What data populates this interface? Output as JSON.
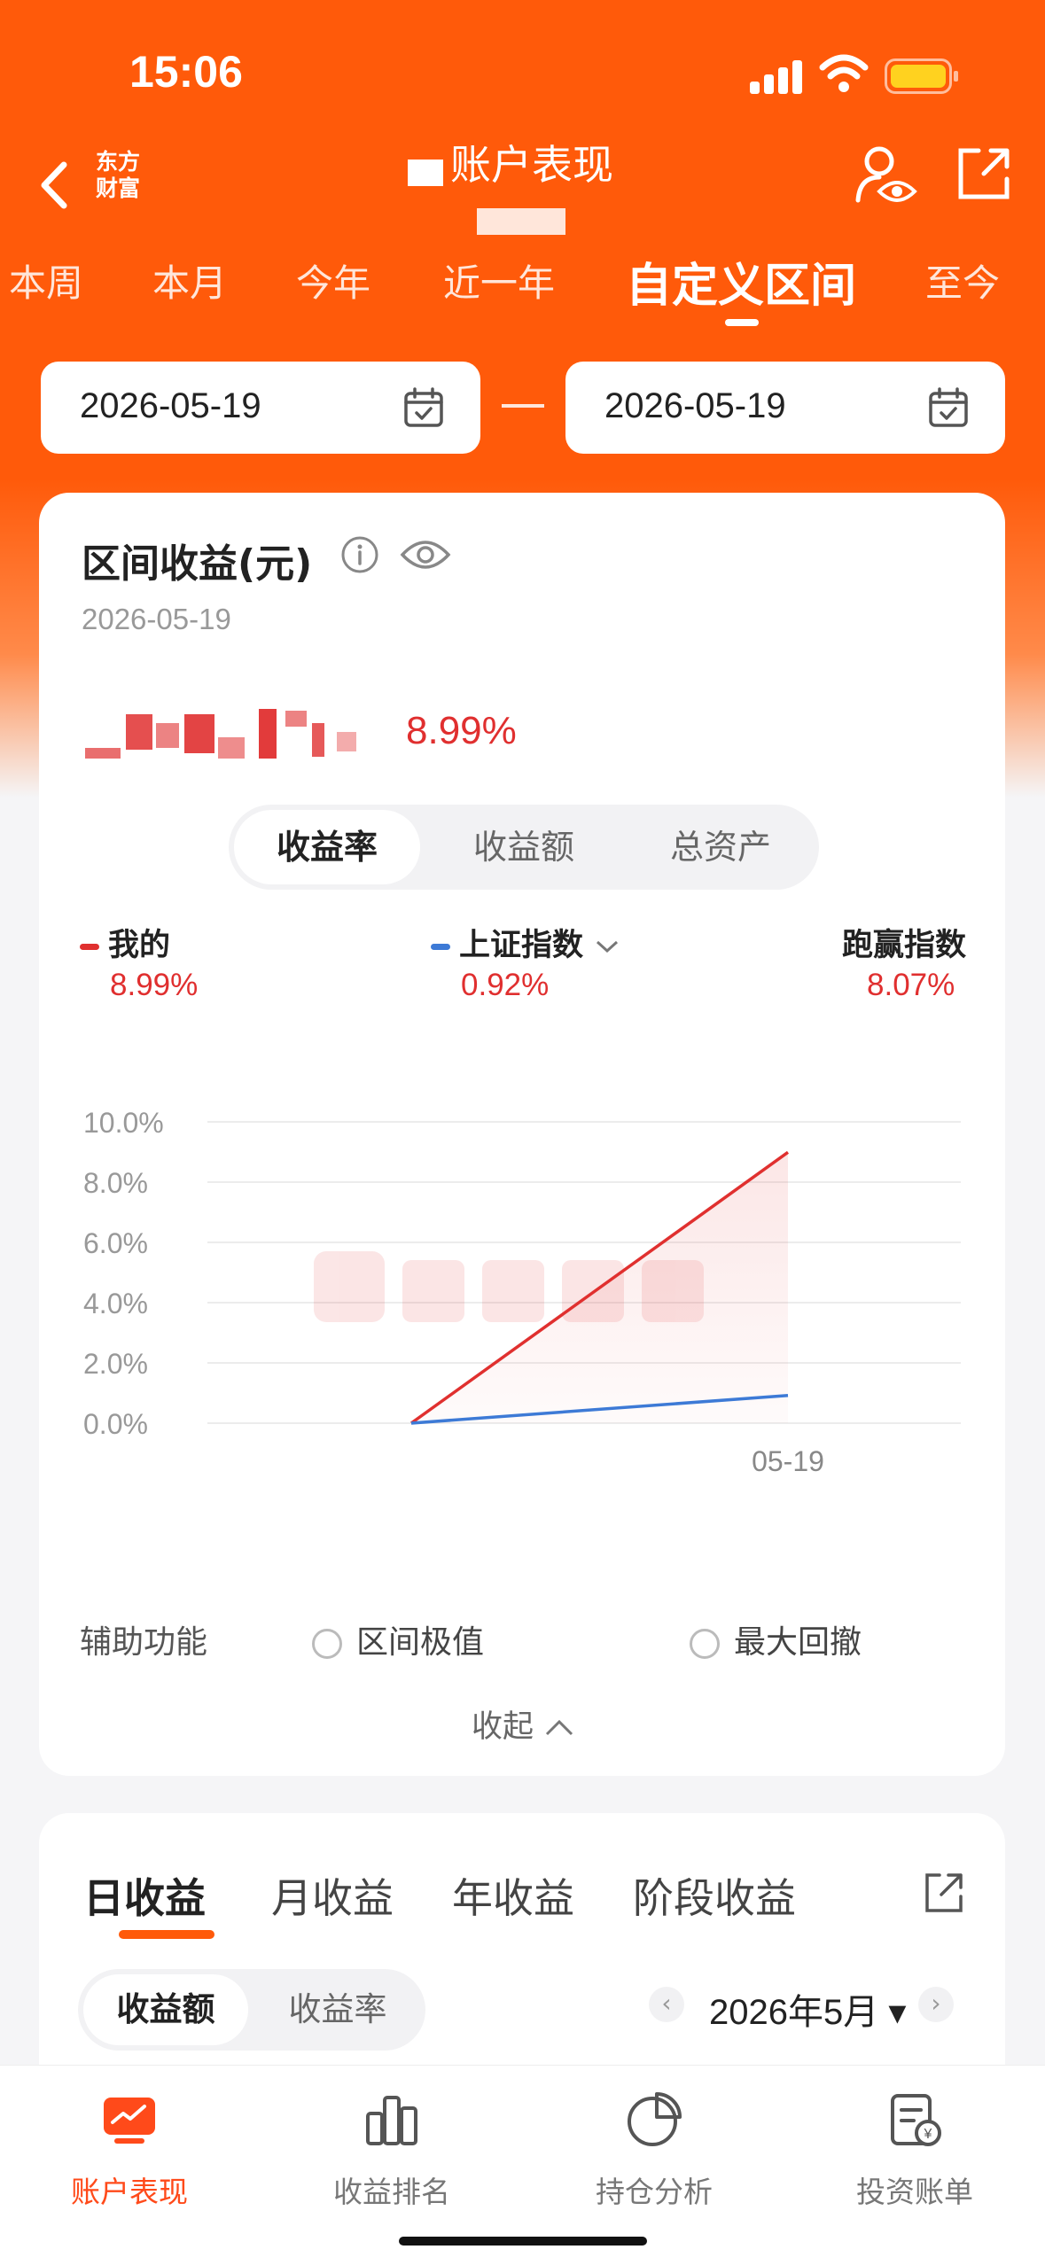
{
  "status": {
    "time": "15:06"
  },
  "nav": {
    "logo_line1": "东方",
    "logo_line2": "财富",
    "title": "账户表现"
  },
  "period_tabs": [
    "本周",
    "本月",
    "今年",
    "近一年",
    "自定义区间",
    "至今"
  ],
  "date_range": {
    "start": "2026-05-19",
    "end": "2026-05-19"
  },
  "summary": {
    "title": "区间收益(元)",
    "date": "2026-05-19",
    "return_pct": "8.99%"
  },
  "segment": [
    "收益率",
    "收益额",
    "总资产"
  ],
  "legend": [
    {
      "label": "我的",
      "value": "8.99%",
      "color": "#e0302f"
    },
    {
      "label": "上证指数",
      "value": "0.92%",
      "color": "#3d7ad6"
    },
    {
      "label": "跑赢指数",
      "value": "8.07%"
    }
  ],
  "chart_data": {
    "type": "line",
    "y_ticks": [
      "10.0%",
      "8.0%",
      "6.0%",
      "4.0%",
      "2.0%",
      "0.0%"
    ],
    "ylim": [
      0,
      10
    ],
    "x_tick_label": "05-19",
    "series": [
      {
        "name": "我的",
        "color": "#e0302f",
        "points": [
          [
            0,
            0.0
          ],
          [
            1,
            8.99
          ]
        ]
      },
      {
        "name": "上证指数",
        "color": "#3d7ad6",
        "points": [
          [
            0,
            0.0
          ],
          [
            1,
            0.92
          ]
        ]
      }
    ]
  },
  "aux": {
    "label": "辅助功能",
    "option1": "区间极值",
    "option2": "最大回撤",
    "collapse": "收起"
  },
  "profit_tabs": [
    "日收益",
    "月收益",
    "年收益",
    "阶段收益"
  ],
  "profit_segment": [
    "收益额",
    "收益率"
  ],
  "month": "2026年5月",
  "tabbar": [
    "账户表现",
    "收益排名",
    "持仓分析",
    "投资账单"
  ],
  "colors": {
    "brand": "#ff5a0a",
    "up": "#e02f2f"
  }
}
